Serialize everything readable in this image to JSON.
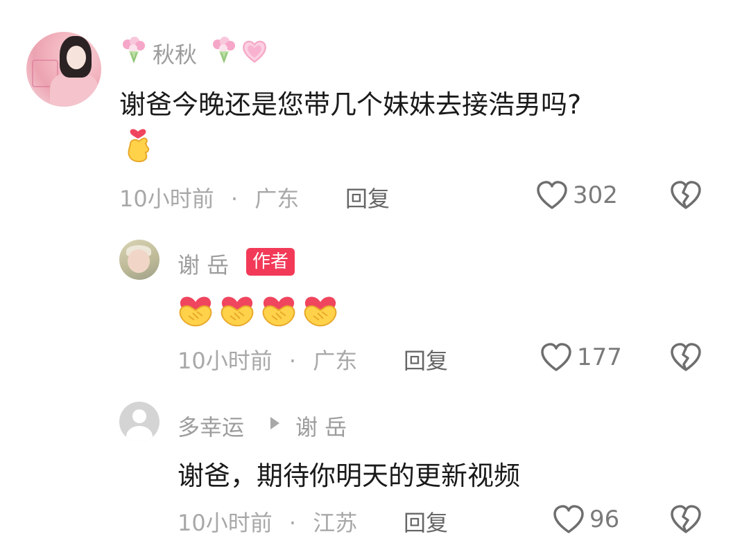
{
  "comments": [
    {
      "username": "秋秋",
      "content": "谢爸今晚还是您带几个妹妹去接浩男吗?",
      "time": "10小时前",
      "location": "广东",
      "reply_label": "回复",
      "likes": "302"
    },
    {
      "username": "谢 岳",
      "badge": "作者",
      "time": "10小时前",
      "location": "广东",
      "reply_label": "回复",
      "likes": "177"
    },
    {
      "username": "多幸运",
      "reply_to": "谢 岳",
      "content": "谢爸，期待你明天的更新视频",
      "time": "10小时前",
      "location": "江苏",
      "reply_label": "回复",
      "likes": "96"
    }
  ],
  "separator": "·",
  "icons": {
    "like": "heart-outline-icon",
    "dislike": "broken-heart-icon",
    "name_decoration": "bouquet-icon",
    "name_heart": "pink-heart-icon",
    "finger_heart": "finger-heart-emoji",
    "handshake_heart": "handshake-heart-emoji"
  },
  "colors": {
    "badge_bg": "#f23a58",
    "text_primary": "#1a1a1a",
    "text_secondary": "#a8a8a8"
  }
}
